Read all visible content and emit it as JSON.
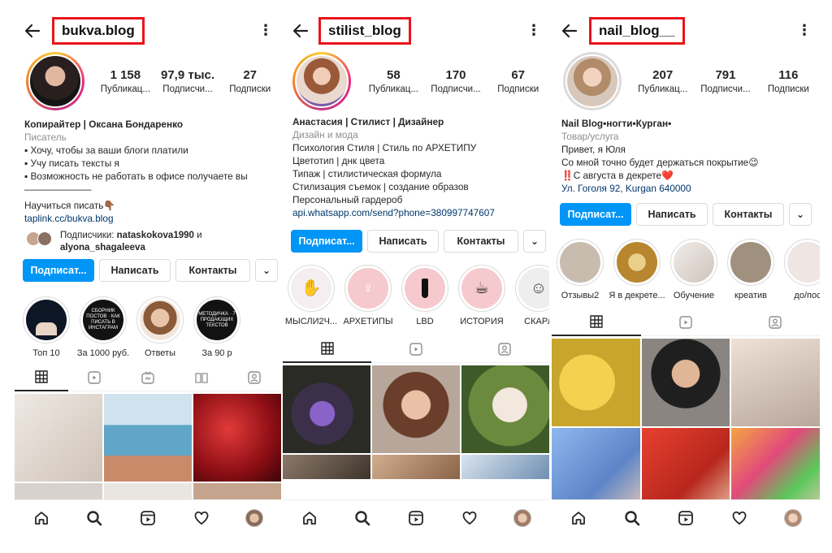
{
  "profiles": [
    {
      "username": "bukva.blog",
      "stats": [
        {
          "num": "1 158",
          "label": "Публикац..."
        },
        {
          "num": "97,9 тыс.",
          "label": "Подписчи..."
        },
        {
          "num": "27",
          "label": "Подписки"
        }
      ],
      "bio": [
        {
          "text": "Копирайтер | Оксана Бондаренко",
          "style": "name"
        },
        {
          "text": "Писатель",
          "style": "cat"
        },
        {
          "text": "▪ Хочу, чтобы за ваши блоги платили",
          "style": ""
        },
        {
          "text": "▪ Учу писать тексты я",
          "style": ""
        },
        {
          "text": "▪ Возможность не работать в офисе получаете вы",
          "style": ""
        },
        {
          "text": "———————",
          "style": ""
        },
        {
          "text": "Научиться писать👇🏾",
          "style": ""
        },
        {
          "text": "taplink.cc/bukva.blog",
          "style": "link"
        }
      ],
      "followers_prefix": "Подписчики: ",
      "followers_names": "nataskokova1990",
      "followers_and": " и",
      "followers_names2": "alyona_shagaleeva",
      "buttons": {
        "follow": "Подписат...",
        "message": "Написать",
        "contacts": "Контакты"
      },
      "highlights": [
        {
          "label": "Топ 10",
          "inner": "",
          "color": "#0d1624"
        },
        {
          "label": "За 1000 руб.",
          "inner": "СБОРНИК ПОСТОВ · КАК ПИСАТЬ В ИНСТАГРАМ",
          "color": "#121212"
        },
        {
          "label": "Ответы",
          "inner": "",
          "color": "#b88a6a"
        },
        {
          "label": "За 90 р",
          "inner": "МЕТОДИЧКА · 7 ПРОДАЮЩИХ ТЕКСТОВ",
          "color": "#121212"
        }
      ],
      "grid_colors": [
        "#d9d4cf",
        "#7fb3c9",
        "#b0161d",
        "#c8c0b8",
        "#e6e3df",
        "#c9a995"
      ]
    },
    {
      "username": "stilist_blog",
      "stats": [
        {
          "num": "58",
          "label": "Публикац..."
        },
        {
          "num": "170",
          "label": "Подписчи..."
        },
        {
          "num": "67",
          "label": "Подписки"
        }
      ],
      "bio": [
        {
          "text": "Анастасия | Стилист | Дизайнер",
          "style": "name"
        },
        {
          "text": "Дизайн и мода",
          "style": "cat"
        },
        {
          "text": "Психология Стиля | Стиль по АРХЕТИПУ",
          "style": ""
        },
        {
          "text": "Цветотип | днк цвета",
          "style": ""
        },
        {
          "text": "Типаж | стилистическая формула",
          "style": ""
        },
        {
          "text": "Стилизация съемок | создание образов",
          "style": ""
        },
        {
          "text": "Персональный гардероб",
          "style": ""
        },
        {
          "text": "api.whatsapp.com/send?phone=380997747607",
          "style": "link"
        }
      ],
      "buttons": {
        "follow": "Подписат...",
        "message": "Написать",
        "contacts": "Контакты"
      },
      "highlights": [
        {
          "label": "МЫСЛИ2Ч...",
          "inner": "",
          "color": "#f4eef0"
        },
        {
          "label": "АРХЕТИПЫ",
          "inner": "",
          "color": "#f6c9cf"
        },
        {
          "label": "LBD",
          "inner": "",
          "color": "#f6c9cf"
        },
        {
          "label": "ИСТОРИЯ",
          "inner": "",
          "color": "#f6c9cf"
        },
        {
          "label": "СКАРЛ",
          "inner": "",
          "color": "#eeeeee"
        }
      ],
      "grid_colors": [
        "#3c3a4a",
        "#8a6a5a",
        "#5b7a3a",
        "#7a6a60",
        "#b99a80",
        "#9fb3c9"
      ]
    },
    {
      "username": "nail_blog__",
      "stats": [
        {
          "num": "207",
          "label": "Публикац..."
        },
        {
          "num": "791",
          "label": "Подписчи..."
        },
        {
          "num": "116",
          "label": "Подписки"
        }
      ],
      "bio": [
        {
          "text": "Nail Blog•ногти•Курган•",
          "style": "name"
        },
        {
          "text": "Товар/услуга",
          "style": "cat"
        },
        {
          "text": "Привет, я Юля",
          "style": ""
        },
        {
          "text": "Со мной точно будет держаться покрытие😉",
          "style": ""
        },
        {
          "text": "‼️С августа в декрете❤️",
          "style": ""
        },
        {
          "text": "Ул. Гоголя 92, Kurgan 640000",
          "style": "link"
        }
      ],
      "buttons": {
        "follow": "Подписат...",
        "message": "Написать",
        "contacts": "Контакты"
      },
      "highlights": [
        {
          "label": "Отзывы2",
          "inner": "",
          "color": "#c7bcae"
        },
        {
          "label": "Я в декрете...",
          "inner": "",
          "color": "#c9a24a"
        },
        {
          "label": "Обучение",
          "inner": "",
          "color": "#e2dcd8"
        },
        {
          "label": "креатив",
          "inner": "",
          "color": "#a0917f"
        },
        {
          "label": "до/пос",
          "inner": "",
          "color": "#efe5e3"
        }
      ],
      "grid_colors": [
        "#e0c14a",
        "#6b6460",
        "#cfb8ad",
        "#7aa0d8",
        "#d8443a",
        "#e89a4a"
      ]
    }
  ],
  "accent": "#0095f6",
  "highlight_box_color": "#e8151b"
}
